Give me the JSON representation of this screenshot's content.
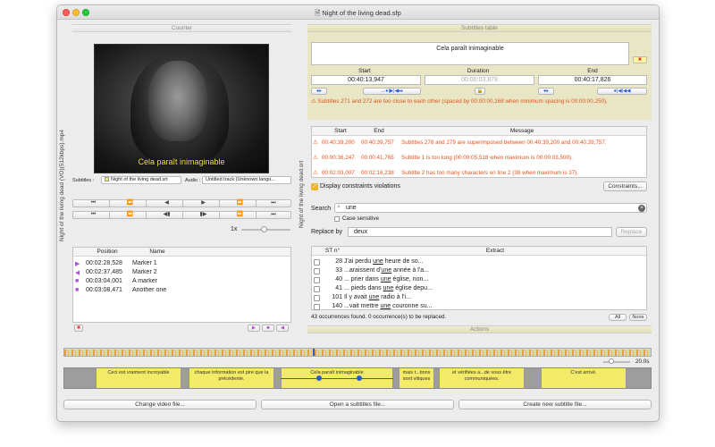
{
  "window": {
    "title": "Night of the living dead.sfp"
  },
  "counter": {
    "header": "Counter",
    "video_file": "Night of the living dead (VO)(512kbps).mp4",
    "subtitle_overlay": "Cela paraît inimaginable",
    "subtitles_label": "Subtitles :",
    "subtitles_value": "Night of the living dead.srt",
    "audio_label": "Audio :",
    "audio_value": "Untitled track (Unknown langu...",
    "speed": "1x"
  },
  "markers": {
    "columns": [
      "Position",
      "Name"
    ],
    "rows": [
      {
        "position": "00:02:28,528",
        "name": "Marker 1",
        "icon": "play-right"
      },
      {
        "position": "00:02:37,485",
        "name": "Marker 2",
        "icon": "play-left"
      },
      {
        "position": "00:03:04,001",
        "name": "A marker",
        "icon": "square"
      },
      {
        "position": "00:03:08,471",
        "name": "Another one",
        "icon": "square"
      }
    ]
  },
  "subtitles_table": {
    "header": "Subtitles table",
    "side_label": "Night of the living dead.srt",
    "current_text": "Cela paraît inimaginable",
    "start_label": "Start",
    "duration_label": "Duration",
    "end_label": "End",
    "start": "00:40:13,947",
    "duration": "00:00:03,879",
    "end": "00:40:17,826",
    "spacing_warning": "Subtitles 271 and 272 are too close to each other (spaced by 00:00:00,168 when minimum spacing is 00:00:00,250).",
    "columns": [
      "Start",
      "End",
      "Message"
    ],
    "violations": [
      {
        "start": "00:40:39,200",
        "end": "00:40:39,757",
        "message": "Subtitles 278 and 279 are superimposed between 00:40:39,200 and 00:40:39,757."
      },
      {
        "start": "00:00:36,247",
        "end": "00:00:41,765",
        "message": "Subtitle 1 is too long (00:00:05,518 when maximum is 00:00:03,500)."
      },
      {
        "start": "00:02:03,007",
        "end": "00:02:16,238",
        "message": "Subtitle 2 has too many characters on line 2 (38 when maximum is 37)."
      }
    ],
    "display_constraints": "Display constraints violations",
    "constraints_button": "Constraints..."
  },
  "search": {
    "label": "Search",
    "value": "une",
    "case_sensitive": "Case sensitive",
    "replace_label": "Replace by",
    "replace_value": "deux",
    "replace_button": "Replace",
    "columns": [
      "ST n°",
      "Extract"
    ],
    "results": [
      {
        "st": "28",
        "pre": "J'ai perdu ",
        "match": "une",
        "post": " heure de so..."
      },
      {
        "st": "33",
        "pre": "...araissent d'",
        "match": "une",
        "post": " année à l'a..."
      },
      {
        "st": "40",
        "pre": "... prier dans ",
        "match": "une",
        "post": " église, non..."
      },
      {
        "st": "41",
        "pre": "... pieds dans ",
        "match": "une",
        "post": " église depu..."
      },
      {
        "st": "101",
        "pre": "Il y avait ",
        "match": "une",
        "post": " radio à l'i..."
      },
      {
        "st": "140",
        "pre": "...vait mettre ",
        "match": "une",
        "post": " couronne su..."
      }
    ],
    "status": "43 occurrences found. 0 occurrence(s) to be replaced.",
    "all_button": "All",
    "none_button": "None"
  },
  "actions": {
    "header": "Actions"
  },
  "timeline": {
    "zoom": "20.0s",
    "segments": [
      {
        "text": "Ceci est vraiment incroyable"
      },
      {
        "text": "chaque information est pire que la précédente."
      },
      {
        "text": "Cela paraît inimaginable"
      },
      {
        "text": "mais t...tions sont vitiques"
      },
      {
        "text": "et vérifiées a...de vous être communiquées."
      },
      {
        "text": "C'est arrivé."
      }
    ]
  },
  "bottom": {
    "change_video": "Change video file...",
    "open_subtitles": "Open a subtitles file...",
    "create_subtitle": "Create new subtitle file..."
  },
  "colors": {
    "accent": "#f3ea68",
    "warning": "#e2541c",
    "panel": "#e8e6c4",
    "selection": "#2b5bd0"
  }
}
